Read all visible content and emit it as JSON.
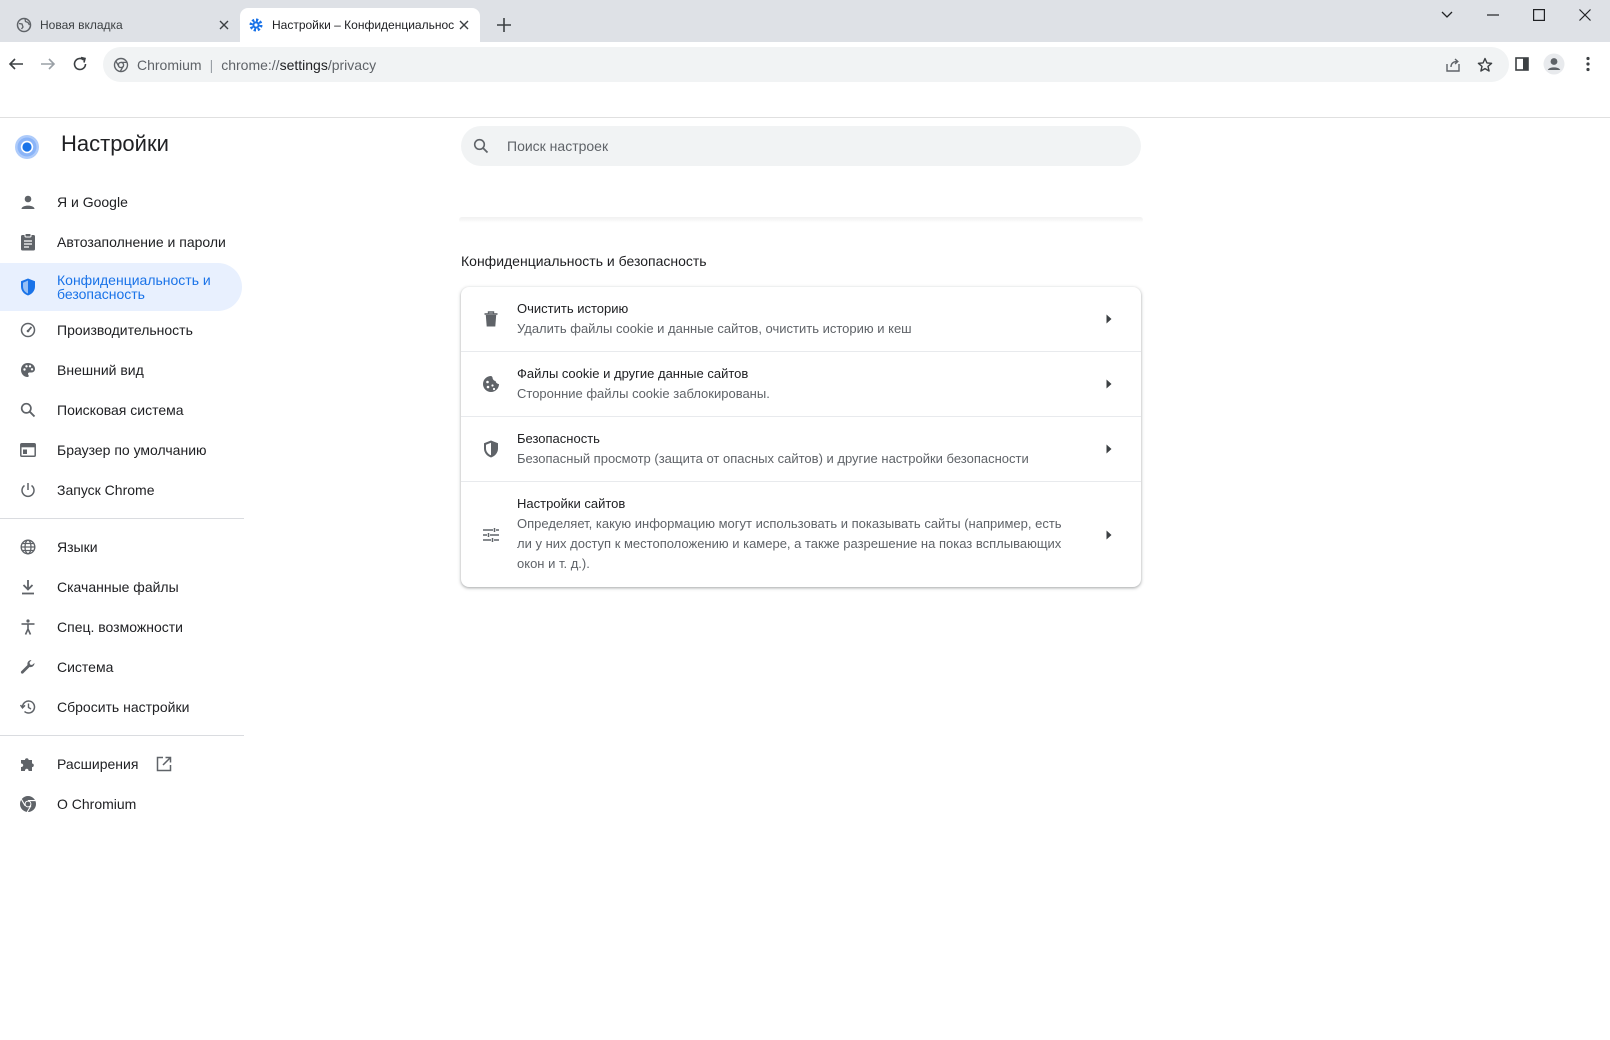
{
  "browser": {
    "tabs": [
      {
        "title": "Новая вкладка",
        "favicon": "globe-icon",
        "active": false
      },
      {
        "title": "Настройки – Конфиденциальность и безопасность",
        "favicon": "gear-icon",
        "active": true
      }
    ],
    "address": {
      "site": "Chromium",
      "url_prefix": "chrome://",
      "url_host": "settings",
      "url_path": "/privacy"
    }
  },
  "settings": {
    "title": "Настройки",
    "search_placeholder": "Поиск настроек"
  },
  "sidebar": {
    "items": [
      {
        "label": "Я и Google",
        "icon": "person-icon"
      },
      {
        "label": "Автозаполнение и пароли",
        "icon": "clipboard-icon"
      },
      {
        "label": "Конфиденциальность и безопасность",
        "icon": "shield-icon",
        "selected": true
      },
      {
        "label": "Производительность",
        "icon": "speedometer-icon"
      },
      {
        "label": "Внешний вид",
        "icon": "palette-icon"
      },
      {
        "label": "Поисковая система",
        "icon": "search-icon"
      },
      {
        "label": "Браузер по умолчанию",
        "icon": "browser-window-icon"
      },
      {
        "label": "Запуск Chrome",
        "icon": "power-icon"
      },
      {
        "label": "Языки",
        "icon": "globe-icon"
      },
      {
        "label": "Скачанные файлы",
        "icon": "download-icon"
      },
      {
        "label": "Спец. возможности",
        "icon": "accessibility-icon"
      },
      {
        "label": "Система",
        "icon": "wrench-icon"
      },
      {
        "label": "Сбросить настройки",
        "icon": "history-icon"
      },
      {
        "label": "Расширения",
        "icon": "puzzle-icon"
      },
      {
        "label": "О Chromium",
        "icon": "chromium-icon"
      }
    ]
  },
  "privacy": {
    "section_title": "Конфиденциальность и безопасность",
    "rows": [
      {
        "title": "Очистить историю",
        "subtitle": "Удалить файлы cookie и данные сайтов, очистить историю и кеш",
        "icon": "trash-icon"
      },
      {
        "title": "Файлы cookie и другие данные сайтов",
        "subtitle": "Сторонние файлы cookie заблокированы.",
        "icon": "cookie-icon"
      },
      {
        "title": "Безопасность",
        "subtitle": "Безопасный просмотр (защита от опасных сайтов) и другие настройки безопасности",
        "icon": "shield-icon"
      },
      {
        "title": "Настройки сайтов",
        "subtitle": "Определяет, какую информацию могут использовать и показывать сайты (например, есть ли у них доступ к местоположению и камере, а также разрешение на показ всплывающих окон и т. д.).",
        "icon": "tune-icon"
      }
    ]
  },
  "colors": {
    "accent": "#1a73e8",
    "selected_bg": "#e8f0fe",
    "tabstrip_bg": "#dee1e6",
    "omnibox_bg": "#f1f3f4"
  }
}
